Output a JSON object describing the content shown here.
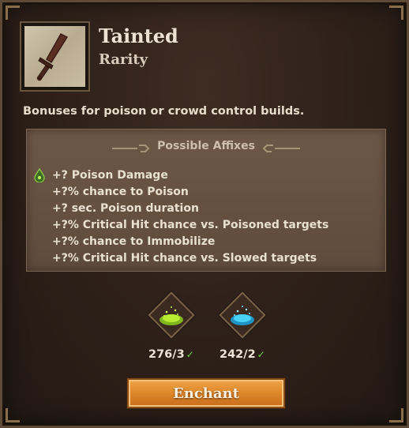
{
  "item": {
    "name": "Tainted",
    "rarity": "Rarity",
    "icon": "dagger-icon",
    "description": "Bonuses for poison or crowd control builds."
  },
  "affixes": {
    "header": "Possible Affixes",
    "items": [
      "+? Poison Damage",
      "+?% chance to Poison",
      "+? sec. Poison duration",
      "+?% Critical Hit chance vs. Poisoned targets",
      "+?% chance to Immobilize",
      "+?% Critical Hit chance vs. Slowed targets"
    ]
  },
  "materials": [
    {
      "icon": "green-dust-icon",
      "count": "276/3",
      "check": "✓",
      "color": "#a8e02a"
    },
    {
      "icon": "blue-dust-icon",
      "count": "242/2",
      "check": "✓",
      "color": "#39c6f0"
    }
  ],
  "actions": {
    "enchant_label": "Enchant"
  }
}
